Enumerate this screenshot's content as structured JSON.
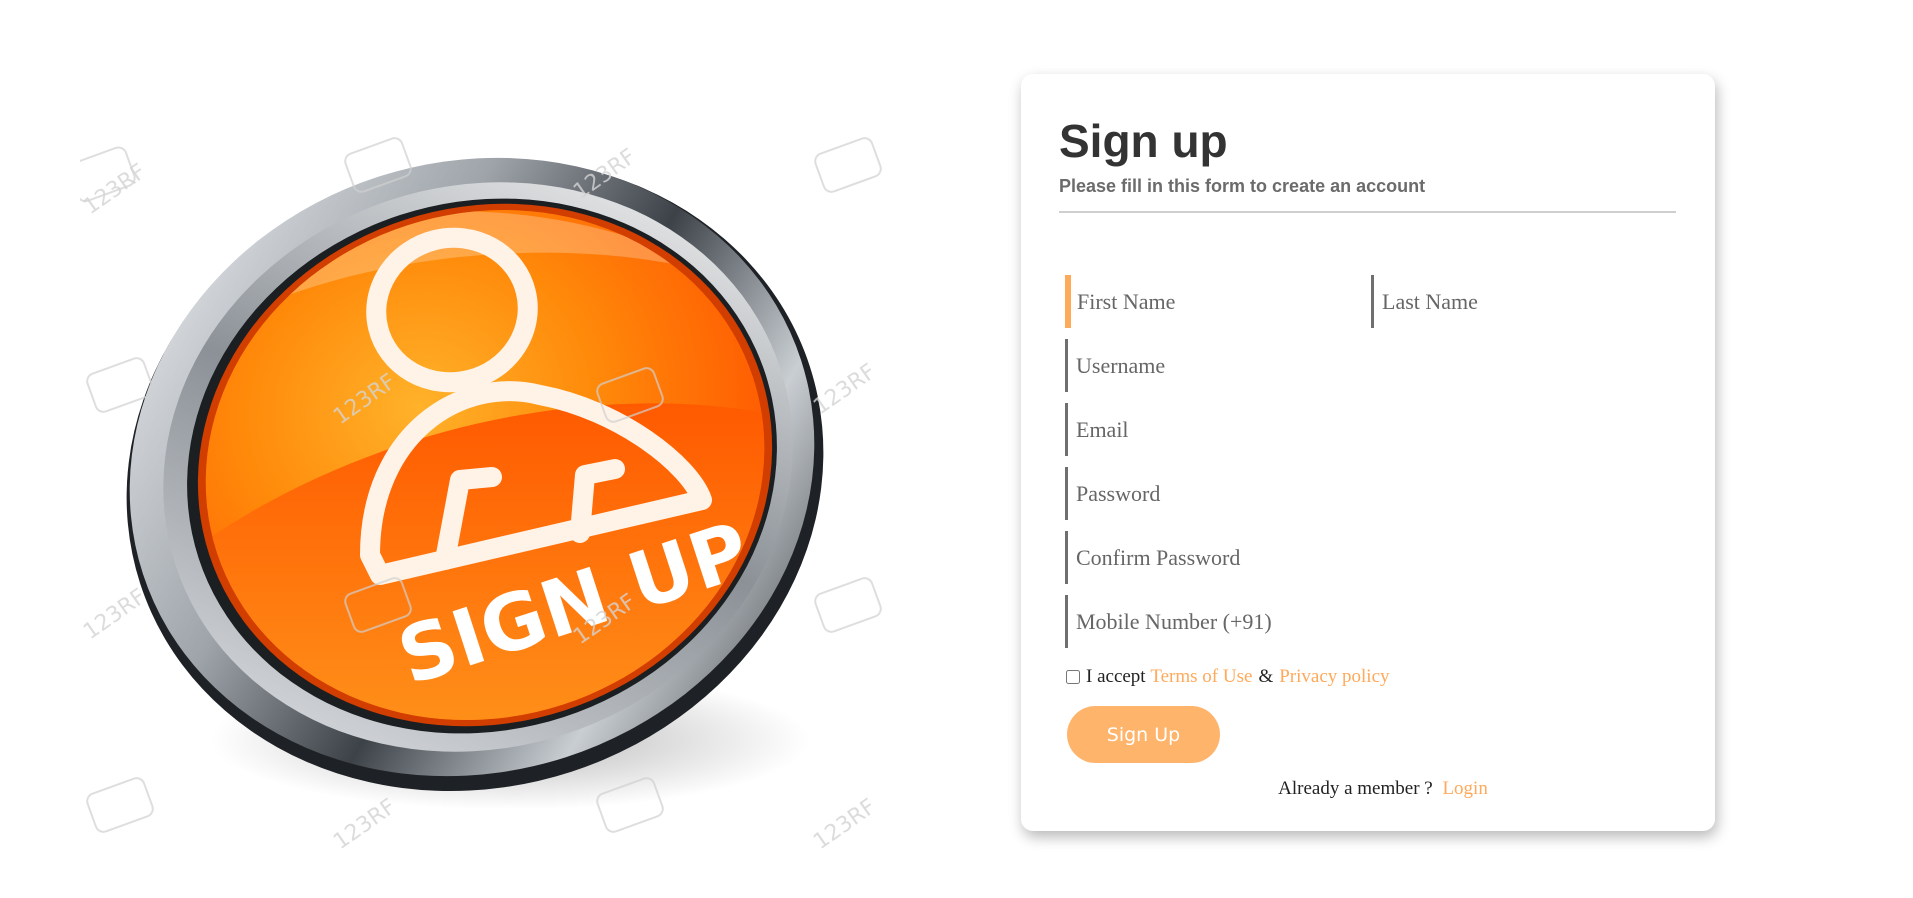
{
  "form": {
    "title": "Sign up",
    "subtitle": "Please fill in this form to create an account",
    "fields": {
      "first_name": {
        "placeholder": "First Name",
        "value": ""
      },
      "last_name": {
        "placeholder": "Last Name",
        "value": ""
      },
      "username": {
        "placeholder": "Username",
        "value": ""
      },
      "email": {
        "placeholder": "Email",
        "value": ""
      },
      "password": {
        "placeholder": "Password",
        "value": ""
      },
      "confirm_password": {
        "placeholder": "Confirm Password",
        "value": ""
      },
      "mobile": {
        "placeholder": "Mobile Number (+91)",
        "value": ""
      }
    },
    "terms": {
      "prefix": "I accept",
      "terms_link": "Terms of Use",
      "ampersand": "&",
      "privacy_link": "Privacy policy",
      "checked": false
    },
    "submit_label": "Sign Up",
    "member_prompt": "Already a member ?",
    "login_link": "Login"
  },
  "hero": {
    "badge_text": "SIGN UP",
    "watermark": "123RF"
  },
  "colors": {
    "accent": "#ffa95a",
    "button": "#ffb46c",
    "title": "#333333",
    "field_border": "#6f6f6f"
  }
}
